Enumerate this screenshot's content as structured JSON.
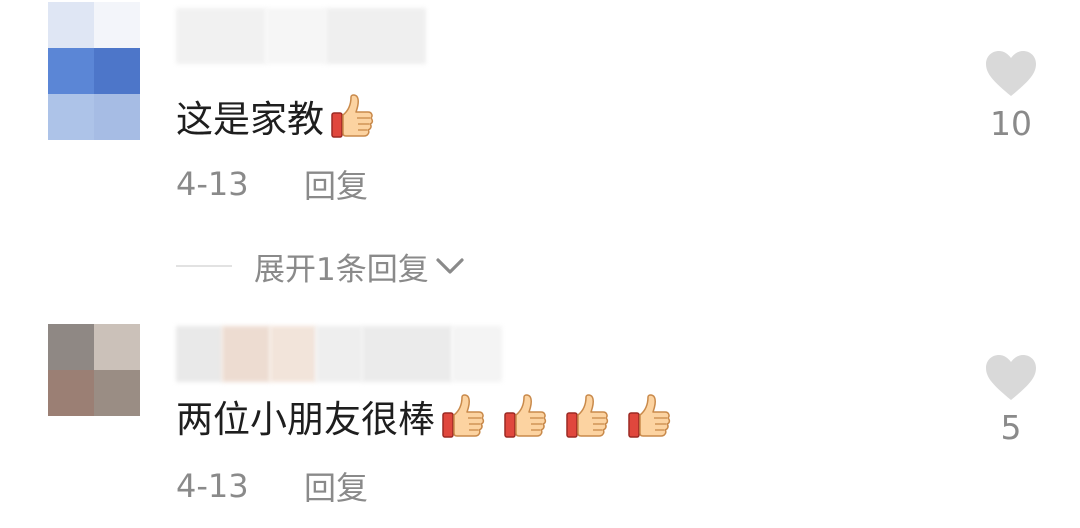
{
  "comments": [
    {
      "text": "这是家教",
      "thumbs": 1,
      "date": "4-13",
      "reply_label": "回复",
      "like_count": "10",
      "expand_label": "展开1条回复"
    },
    {
      "text": "两位小朋友很棒",
      "thumbs": 4,
      "date": "4-13",
      "reply_label": "回复",
      "like_count": "5"
    }
  ],
  "icons": {
    "like": "heart-icon",
    "expand": "chevron-down-icon",
    "emoji": "thumbs-up-emoji-icon"
  },
  "colors": {
    "text": "#1e1e1e",
    "muted": "#8a8a8a",
    "heart": "#d9d9d9",
    "avatar1": [
      "#dfe6f4",
      "#f3f5fa",
      "#5b86d6",
      "#4d76c9",
      "#adc3e8",
      "#a6bce4"
    ],
    "avatar2": [
      "#8f8884",
      "#cbc1b9",
      "#9b7f74",
      "#9a8d84"
    ]
  }
}
